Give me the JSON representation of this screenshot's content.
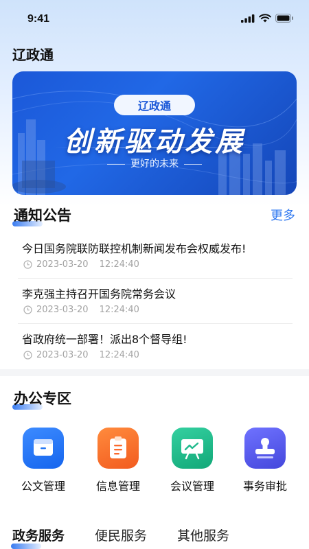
{
  "status_bar": {
    "time": "9:41"
  },
  "header": {
    "title": "辽政通"
  },
  "banner": {
    "pill": "辽政通",
    "slogan": "创新驱动发展",
    "subtitle": "更好的未来"
  },
  "notices": {
    "title": "通知公告",
    "more": "更多",
    "items": [
      {
        "title": "今日国务院联防联控机制新闻发布会权威发布!",
        "date": "2023-03-20",
        "time": "12:24:40"
      },
      {
        "title": "李克强主持召开国务院常务会议",
        "date": "2023-03-20",
        "time": "12:24:40"
      },
      {
        "title": "省政府统一部署！派出8个督导组!",
        "date": "2023-03-20",
        "time": "12:24:40"
      }
    ]
  },
  "office": {
    "title": "办公专区",
    "items": [
      {
        "label": "公文管理",
        "icon": "document-folder-icon",
        "color": "#1f73f5"
      },
      {
        "label": "信息管理",
        "icon": "clipboard-icon",
        "color": "#fb6a2c"
      },
      {
        "label": "会议管理",
        "icon": "presentation-board-icon",
        "color": "#1fb98c"
      },
      {
        "label": "事务审批",
        "icon": "approval-stamp-icon",
        "color": "#5557ea"
      }
    ]
  },
  "service_tabs": {
    "items": [
      {
        "label": "政务服务",
        "active": true
      },
      {
        "label": "便民服务",
        "active": false
      },
      {
        "label": "其他服务",
        "active": false
      }
    ]
  }
}
